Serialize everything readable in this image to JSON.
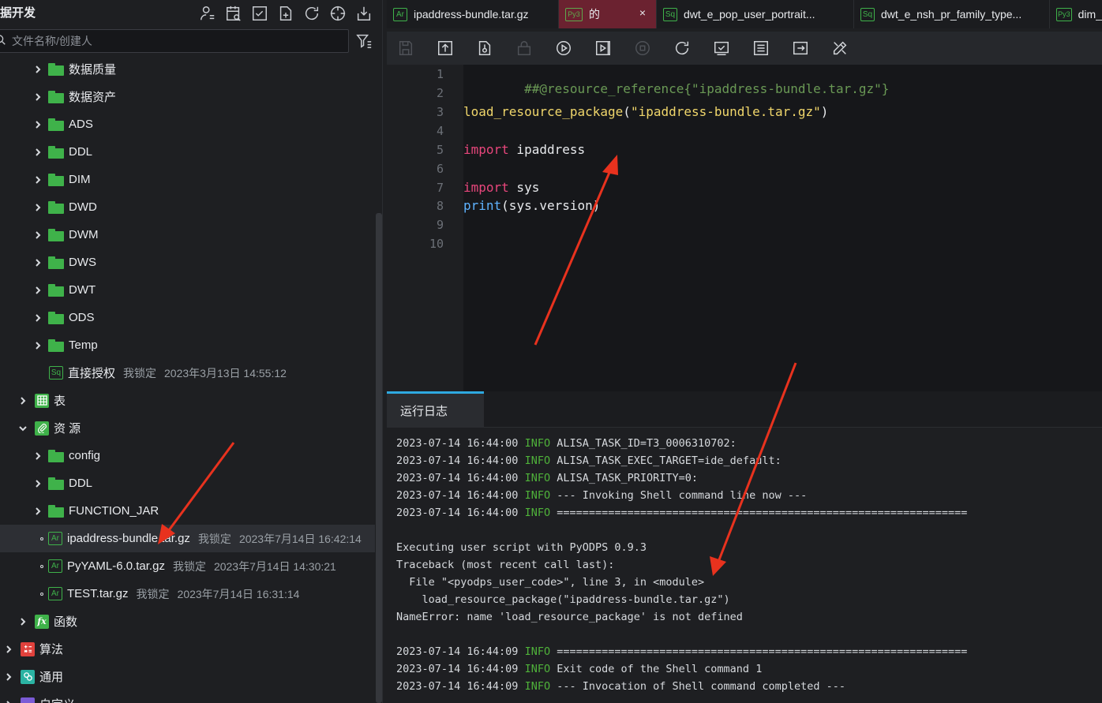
{
  "sidebar": {
    "title": "据开发",
    "search_placeholder": "文件名称/创建人",
    "tree": [
      {
        "label": "数据质量",
        "type": "folder"
      },
      {
        "label": "数据资产",
        "type": "folder"
      },
      {
        "label": "ADS",
        "type": "folder"
      },
      {
        "label": "DDL",
        "type": "folder"
      },
      {
        "label": "DIM",
        "type": "folder"
      },
      {
        "label": "DWD",
        "type": "folder"
      },
      {
        "label": "DWM",
        "type": "folder"
      },
      {
        "label": "DWS",
        "type": "folder"
      },
      {
        "label": "DWT",
        "type": "folder"
      },
      {
        "label": "ODS",
        "type": "folder"
      },
      {
        "label": "Temp",
        "type": "folder"
      },
      {
        "label": "直接授权",
        "type": "sql-file",
        "badge": "Sq",
        "lock": "我锁定",
        "time": "2023年3月13日 14:55:12"
      },
      {
        "label": "表",
        "type": "category"
      },
      {
        "label": "资 源",
        "type": "category-open"
      },
      {
        "label": "config",
        "type": "folder"
      },
      {
        "label": "DDL",
        "type": "folder"
      },
      {
        "label": "FUNCTION_JAR",
        "type": "folder"
      },
      {
        "label": "ipaddress-bundle.tar.gz",
        "type": "archive",
        "badge": "Ar",
        "lock": "我锁定",
        "time": "2023年7月14日 16:42:14"
      },
      {
        "label": "PyYAML-6.0.tar.gz",
        "type": "archive",
        "badge": "Ar",
        "lock": "我锁定",
        "time": "2023年7月14日 14:30:21"
      },
      {
        "label": "TEST.tar.gz",
        "type": "archive",
        "badge": "Ar",
        "lock": "我锁定",
        "time": "2023年7月14日 16:31:14"
      },
      {
        "label": "函数",
        "type": "category"
      },
      {
        "label": "算法",
        "type": "category"
      },
      {
        "label": "通用",
        "type": "category"
      },
      {
        "label": "自定义",
        "type": "category"
      }
    ]
  },
  "tabs": [
    {
      "badge": "Ar",
      "label": "ipaddress-bundle.tar.gz"
    },
    {
      "badge": "Py3",
      "label": "的",
      "close": "×"
    },
    {
      "badge": "Sq",
      "label": "dwt_e_pop_user_portrait..."
    },
    {
      "badge": "Sq",
      "label": "dwt_e_nsh_pr_family_type..."
    },
    {
      "badge": "Py3",
      "label": "dim_"
    }
  ],
  "code": {
    "line_numbers": [
      "1",
      "2",
      "3",
      "4",
      "5",
      "6",
      "7",
      "8",
      "9",
      "10"
    ],
    "line1": "##@resource_reference{\"ipaddress-bundle.tar.gz\"}",
    "line3_func": "load_resource_package",
    "line3_open": "(",
    "line3_str": "\"ipaddress-bundle.tar.gz\"",
    "line3_close": ")",
    "line5_kw": "import",
    "line5_rest": " ipaddress",
    "line7_kw": "import",
    "line7_rest": " sys",
    "line8_builtin": "print",
    "line8_rest": "(sys.version)"
  },
  "log": {
    "tab_label": "运行日志",
    "lines": [
      {
        "ts": "2023-07-14 16:44:00",
        "level": "INFO",
        "msg": "ALISA_TASK_ID=T3_0006310702:"
      },
      {
        "ts": "2023-07-14 16:44:00",
        "level": "INFO",
        "msg": "ALISA_TASK_EXEC_TARGET=ide_default:"
      },
      {
        "ts": "2023-07-14 16:44:00",
        "level": "INFO",
        "msg": "ALISA_TASK_PRIORITY=0:"
      },
      {
        "ts": "2023-07-14 16:44:00",
        "level": "INFO",
        "msg": "--- Invoking Shell command line now ---"
      },
      {
        "ts": "2023-07-14 16:44:00",
        "level": "INFO",
        "msg": "================================================================"
      },
      {
        "plain": ""
      },
      {
        "plain": "Executing user script with PyODPS 0.9.3"
      },
      {
        "plain": "Traceback (most recent call last):"
      },
      {
        "plain": "  File \"<pyodps_user_code>\", line 3, in <module>"
      },
      {
        "plain": "    load_resource_package(\"ipaddress-bundle.tar.gz\")"
      },
      {
        "plain": "NameError: name 'load_resource_package' is not defined"
      },
      {
        "plain": ""
      },
      {
        "ts": "2023-07-14 16:44:09",
        "level": "INFO",
        "msg": "================================================================"
      },
      {
        "ts": "2023-07-14 16:44:09",
        "level": "INFO",
        "msg": "Exit code of the Shell command 1"
      },
      {
        "ts": "2023-07-14 16:44:09",
        "level": "INFO",
        "msg": "--- Invocation of Shell command completed ---"
      }
    ]
  },
  "colors": {
    "accent_green": "#3fb24a",
    "active_tab": "#6b2230",
    "log_tab_accent": "#2ea9e0",
    "arrow": "#e8321e"
  }
}
